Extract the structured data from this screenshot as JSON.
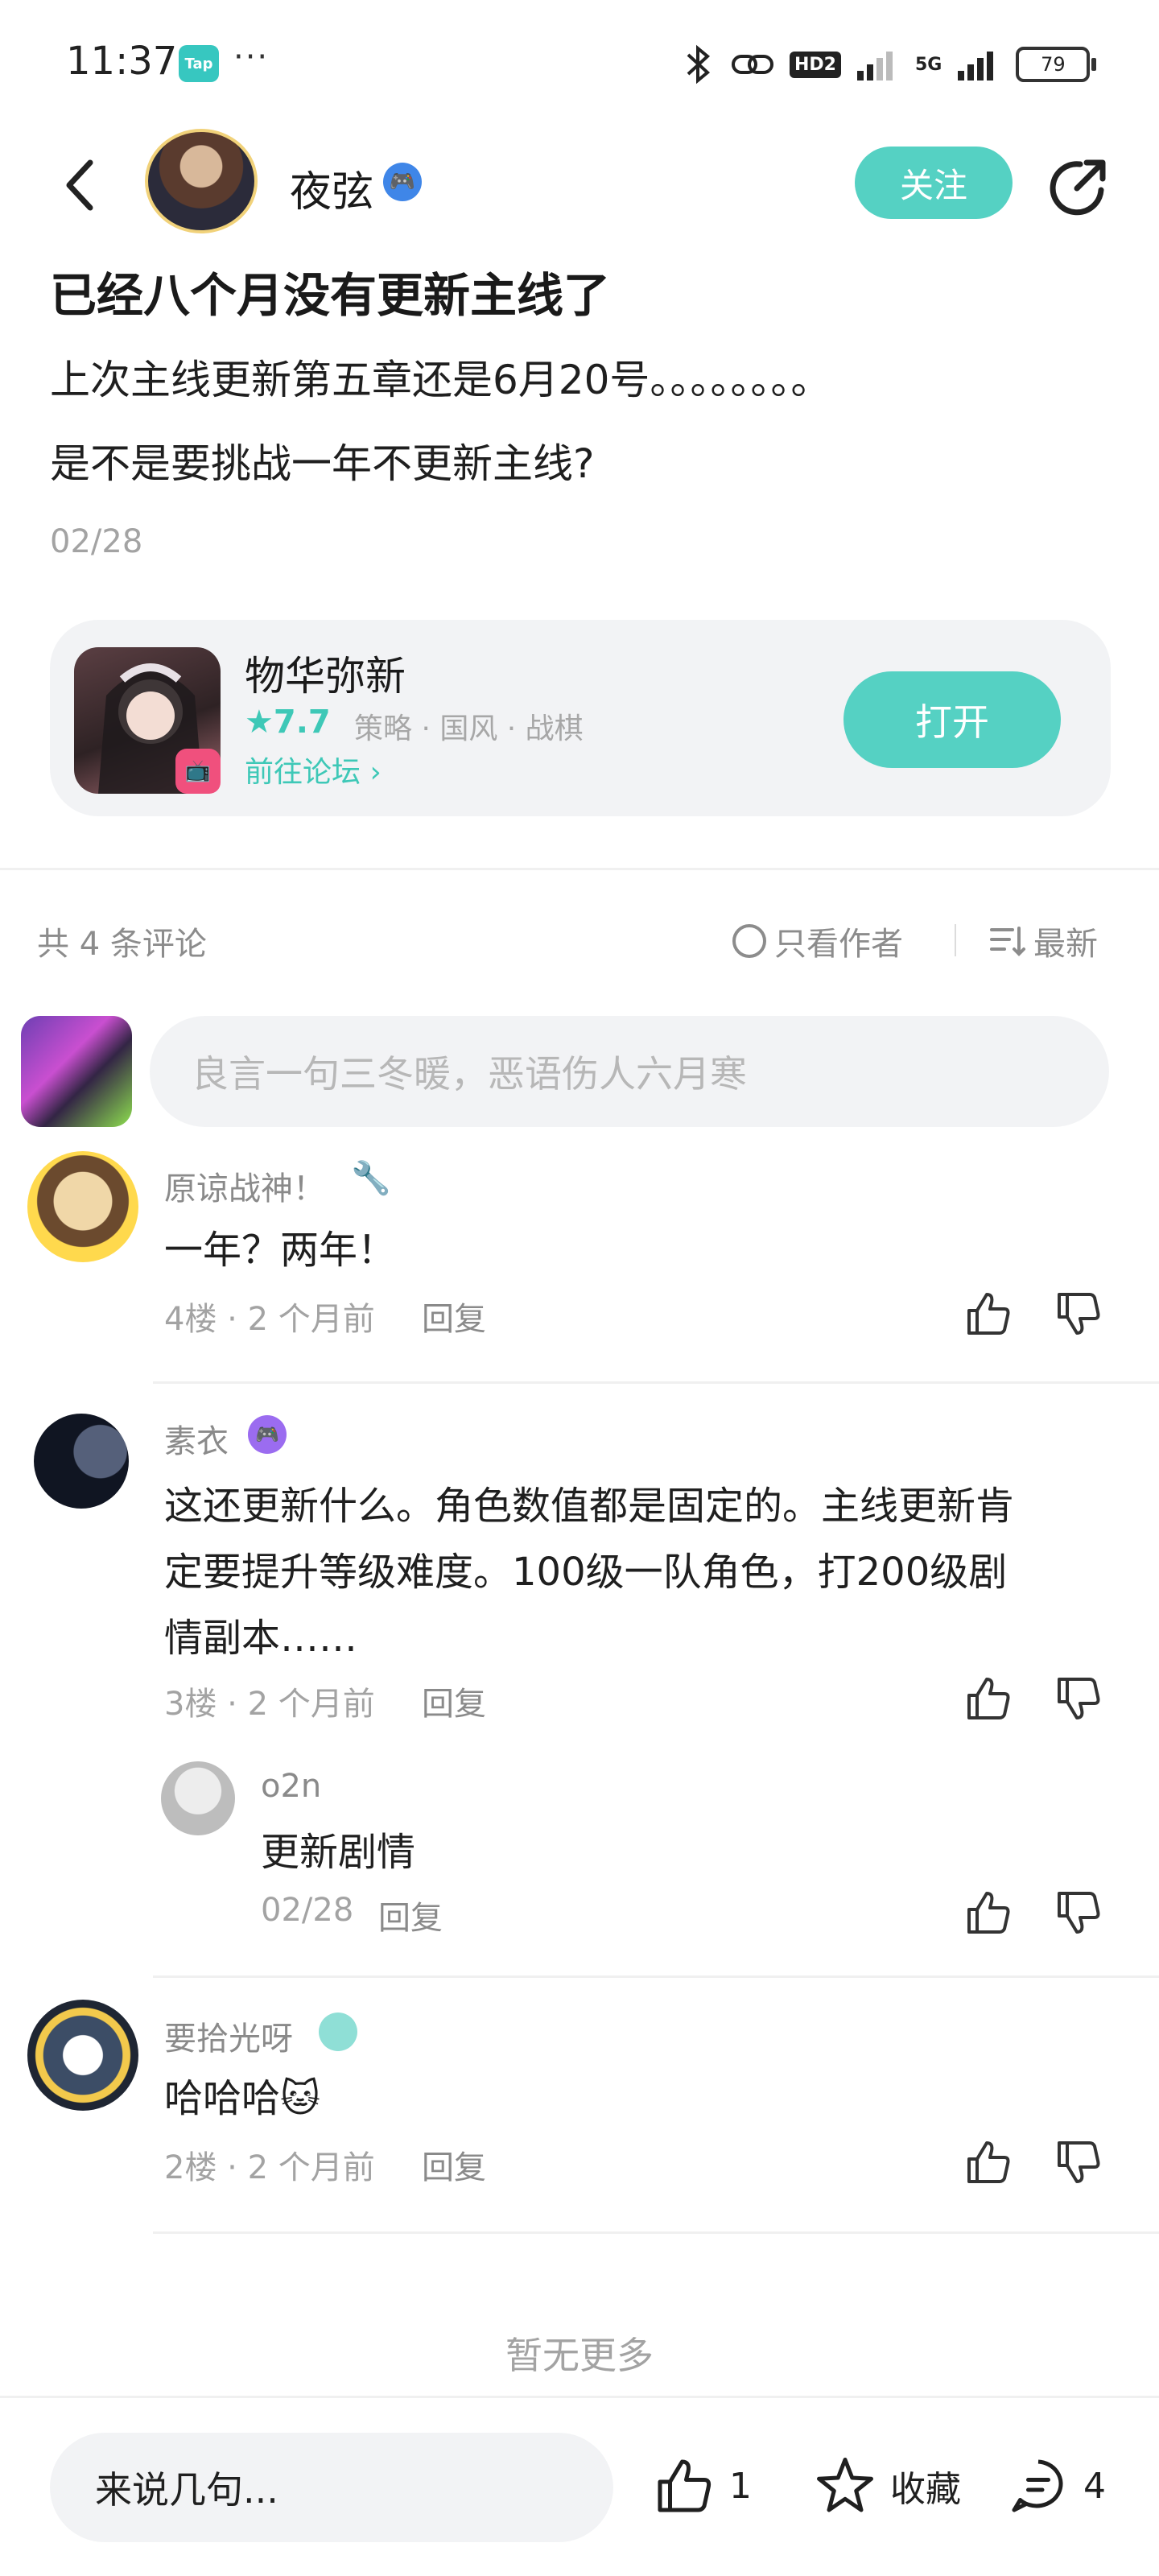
{
  "status_bar": {
    "time": "11:37",
    "app_badge": "Tap",
    "more": "···",
    "network": "HD2",
    "signal_label": "5G",
    "battery": "79"
  },
  "header": {
    "author_name": "夜弦",
    "follow_label": "关注"
  },
  "post": {
    "title": "已经八个月没有更新主线了",
    "line1": "上次主线更新第五章还是6月20号。。。。。。。。",
    "line2": "是不是要挑战一年不更新主线?",
    "date": "02/28"
  },
  "game_card": {
    "name": "物华弥新",
    "rating": "★7.7",
    "tags": "策略 · 国风 · 战棋",
    "forum_link": "前往论坛 ›",
    "open_label": "打开"
  },
  "comments_header": {
    "count": "共 4 条评论",
    "only_author": "只看作者",
    "sort": "最新"
  },
  "comment_input": {
    "placeholder": "良言一句三冬暖，恶语伤人六月寒"
  },
  "comments": [
    {
      "user": "原谅战神！",
      "body": "一年？两年！",
      "floor": "4楼 · 2 个月前",
      "reply": "回复"
    },
    {
      "user": "素衣",
      "body_lines": [
        "这还更新什么。角色数值都是固定的。主线更新肯",
        "定要提升等级难度。100级一队角色，打200级剧",
        "情副本……"
      ],
      "floor": "3楼 · 2 个月前",
      "reply": "回复",
      "sub_reply": {
        "user": "o2n",
        "body": "更新剧情",
        "meta": "02/28",
        "reply": "回复"
      }
    },
    {
      "user": "要拾光呀",
      "body": "哈哈哈🐱",
      "floor": "2楼 · 2 个月前",
      "reply": "回复"
    }
  ],
  "footer": {
    "no_more": "暂无更多"
  },
  "bottom_bar": {
    "input_placeholder": "来说几句...",
    "like_count": "1",
    "favorite_label": "收藏",
    "comment_count": "4"
  },
  "colors": {
    "accent": "#55d1c3",
    "accent_text": "#3ec8b7",
    "muted": "#a3a3a3"
  }
}
